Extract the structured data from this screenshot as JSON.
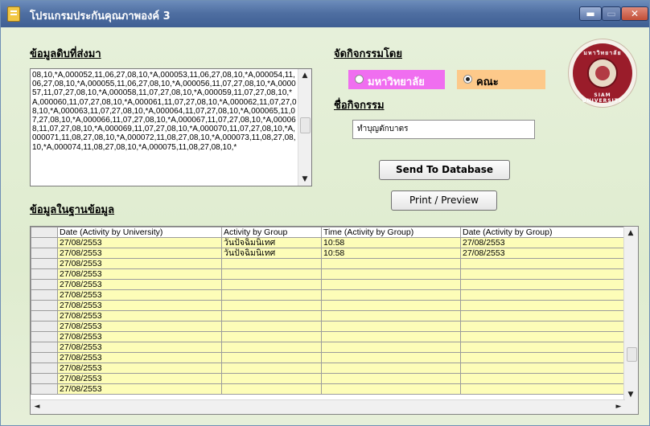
{
  "window": {
    "title": "โปรแกรมประกันคุณภาพองค์ 3",
    "minimize_label": "▬",
    "maximize_label": "▭",
    "close_label": "✕"
  },
  "raw_section": {
    "heading": "ข้อมูลดิบที่ส่งมา",
    "text": "08,10,*A,000052,11,06,27,08,10,*A,000053,11,06,27,08,10,*A,000054,11,06,27,08,10,*A,000055,11,06,27,08,10,*A,000056,11,07,27,08,10,*A,000057,11,07,27,08,10,*A,000058,11,07,27,08,10,*A,000059,11,07,27,08,10,*A,000060,11,07,27,08,10,*A,000061,11,07,27,08,10,*A,000062,11,07,27,08,10,*A,000063,11,07,27,08,10,*A,000064,11,07,27,08,10,*A,000065,11,07,27,08,10,*A,000066,11,07,27,08,10,*A,000067,11,07,27,08,10,*A,000068,11,07,27,08,10,*A,000069,11,07,27,08,10,*A,000070,11,07,27,08,10,*A,000071,11,08,27,08,10,*A,000072,11,08,27,08,10,*A,000073,11,08,27,08,10,*A,000074,11,08,27,08,10,*A,000075,11,08,27,08,10,*"
  },
  "organizer": {
    "heading": "จัดกิจกรรมโดย",
    "options": [
      {
        "label": "มหาวิทยาลัย",
        "selected": false,
        "color": "#f06ef0"
      },
      {
        "label": "คณะ",
        "selected": true,
        "color": "#fdc98a"
      }
    ]
  },
  "activity": {
    "heading": "ชื่อกิจกรรม",
    "value": "ทำบุญตักบาตร"
  },
  "buttons": {
    "send": "Send To Database",
    "print": "Print / Preview"
  },
  "logo": {
    "text_top": "มหาวิทยาลัยสยาม",
    "text_bottom": "SIAM UNIVERSITY"
  },
  "db_section": {
    "heading": "ข้อมูลในฐานข้อมูล",
    "columns": [
      "Date (Activity by University)",
      "Activity by Group",
      "Time (Activity by Group)",
      "Date (Activity by Group)"
    ],
    "rows": [
      [
        "27/08/2553",
        "วันปัจฉิมนิเทศ",
        "10:58",
        "27/08/2553"
      ],
      [
        "27/08/2553",
        "วันปัจฉิมนิเทศ",
        "10:58",
        "27/08/2553"
      ],
      [
        "27/08/2553",
        "",
        "",
        ""
      ],
      [
        "27/08/2553",
        "",
        "",
        ""
      ],
      [
        "27/08/2553",
        "",
        "",
        ""
      ],
      [
        "27/08/2553",
        "",
        "",
        ""
      ],
      [
        "27/08/2553",
        "",
        "",
        ""
      ],
      [
        "27/08/2553",
        "",
        "",
        ""
      ],
      [
        "27/08/2553",
        "",
        "",
        ""
      ],
      [
        "27/08/2553",
        "",
        "",
        ""
      ],
      [
        "27/08/2553",
        "",
        "",
        ""
      ],
      [
        "27/08/2553",
        "",
        "",
        ""
      ],
      [
        "27/08/2553",
        "",
        "",
        ""
      ],
      [
        "27/08/2553",
        "",
        "",
        ""
      ],
      [
        "27/08/2553",
        "",
        "",
        ""
      ]
    ]
  },
  "scroll": {
    "up_arrow": "▲",
    "down_arrow": "▼",
    "left_arrow": "◄",
    "right_arrow": "►"
  }
}
